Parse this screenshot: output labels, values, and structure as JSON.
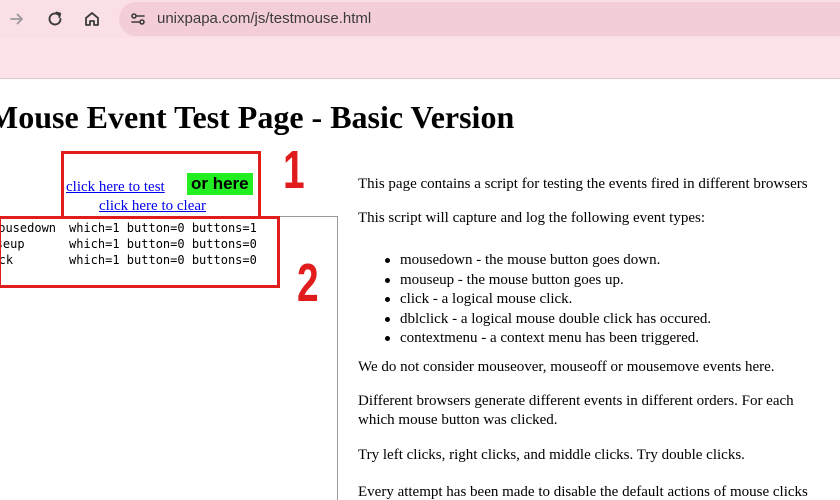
{
  "browser": {
    "url": "unixpapa.com/js/testmouse.html",
    "icons": [
      "forward-icon",
      "reload-icon",
      "home-icon",
      "site-info-icon"
    ]
  },
  "page": {
    "title": "Mouse Event Test Page - Basic Version",
    "link_test": "click here to test",
    "link_clear": "click here to clear",
    "green_button": "or here",
    "log": [
      {
        "event": "mousedown",
        "details": "which=1 button=0 buttons=1"
      },
      {
        "event": "mouseup",
        "details": "which=1 button=0 buttons=0"
      },
      {
        "event": "click",
        "details": "which=1 button=0 buttons=0"
      }
    ],
    "paragraphs": {
      "p1": "This page contains a script for testing the events fired in different browsers",
      "p2": "This script will capture and log the following event types:",
      "p3": "We do not consider mouseover, mouseoff or mousemove events here.",
      "p4a": "Different browsers generate different events in different orders. For each",
      "p4b": "which mouse button was clicked.",
      "p5": "Try left clicks, right clicks, and middle clicks. Try double clicks.",
      "p6": "Every attempt has been made to disable the default actions of mouse clicks"
    },
    "event_types": [
      "mousedown - the mouse button goes down.",
      "mouseup - the mouse button goes up.",
      "click - a logical mouse click.",
      "dblclick - a logical mouse double click has occured.",
      "contextmenu - a context menu has been triggered."
    ]
  },
  "annotations": {
    "label1": "1",
    "label2": "2",
    "color": "#e01c1c"
  }
}
